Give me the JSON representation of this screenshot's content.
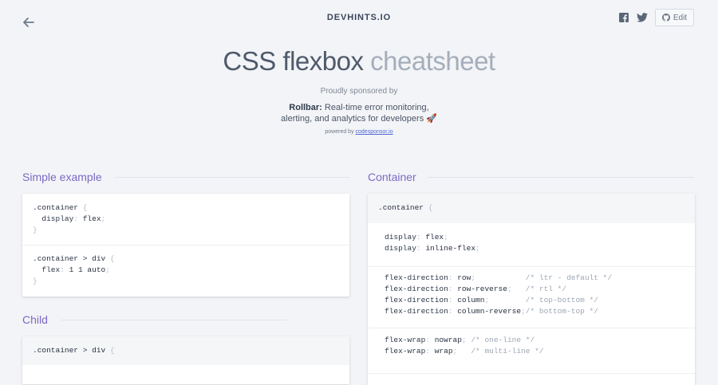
{
  "header": {
    "brand": "DEVHINTS.IO",
    "edit_label": "Edit"
  },
  "hero": {
    "title_main": "CSS flexbox",
    "title_light": "cheatsheet",
    "sponsor_label": "Proudly sponsored by",
    "sponsor_name": "Rollbar:",
    "sponsor_line1": " Real-time error monitoring,",
    "sponsor_line2": "alerting, and analytics for developers 🚀",
    "powered_prefix": "powered by ",
    "powered_link": "codesponsor.io"
  },
  "sections": {
    "simple": {
      "title": "Simple example",
      "block1": [
        ".container",
        " {",
        "display",
        "flex",
        "}"
      ],
      "block2": [
        ".container > div",
        " {",
        "flex",
        "1 1 auto",
        "}"
      ]
    },
    "child": {
      "title": "Child",
      "line": ".container > div"
    },
    "container": {
      "title": "Container",
      "selector": ".container",
      "display": [
        "display",
        "flex",
        "inline-flex"
      ],
      "direction": [
        {
          "prop": "flex-direction",
          "val": "row",
          "pad": "           ",
          "comment": "/* ltr - default */"
        },
        {
          "prop": "flex-direction",
          "val": "row-reverse",
          "pad": "   ",
          "comment": "/* rtl */"
        },
        {
          "prop": "flex-direction",
          "val": "column",
          "pad": "        ",
          "comment": "/* top-bottom */"
        },
        {
          "prop": "flex-direction",
          "val": "column-reverse",
          "pad": "",
          "comment": "/* bottom-top */"
        }
      ],
      "wrap": [
        {
          "prop": "flex-wrap",
          "val": "nowrap",
          "pad": " ",
          "comment": "/* one-line */"
        },
        {
          "prop": "flex-wrap",
          "val": "wrap",
          "pad": "   ",
          "comment": "/* multi-line */"
        }
      ]
    }
  },
  "colors": {
    "accent": "#7c69c6",
    "background": "#f3f4f7"
  },
  "icons": [
    "arrow-left-icon",
    "facebook-icon",
    "twitter-icon",
    "github-icon"
  ]
}
